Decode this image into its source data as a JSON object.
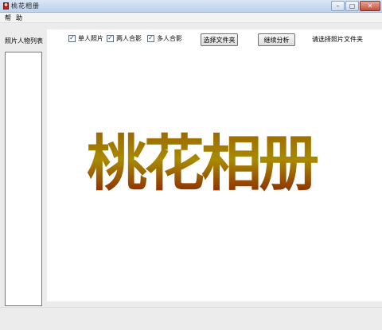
{
  "window": {
    "title": "桃花相册",
    "minimize_glyph": "–",
    "maximize_glyph": "▢",
    "close_glyph": "✕"
  },
  "menu": {
    "items": [
      "帮",
      "助"
    ]
  },
  "left_panel": {
    "label": "照片人物列表"
  },
  "toolbar": {
    "checkboxes": [
      {
        "label": "单人照片",
        "checked": true
      },
      {
        "label": "两人合影",
        "checked": true
      },
      {
        "label": "多人合影",
        "checked": true
      }
    ],
    "select_folder_label": "选择文件夹",
    "continue_label": "继续分析",
    "status": "请选择照片文件夹"
  },
  "logo": {
    "text": "桃花相册",
    "gradient_top": "#9a6400",
    "gradient_mid": "#a88a00",
    "gradient_bottom": "#8a1c00"
  }
}
